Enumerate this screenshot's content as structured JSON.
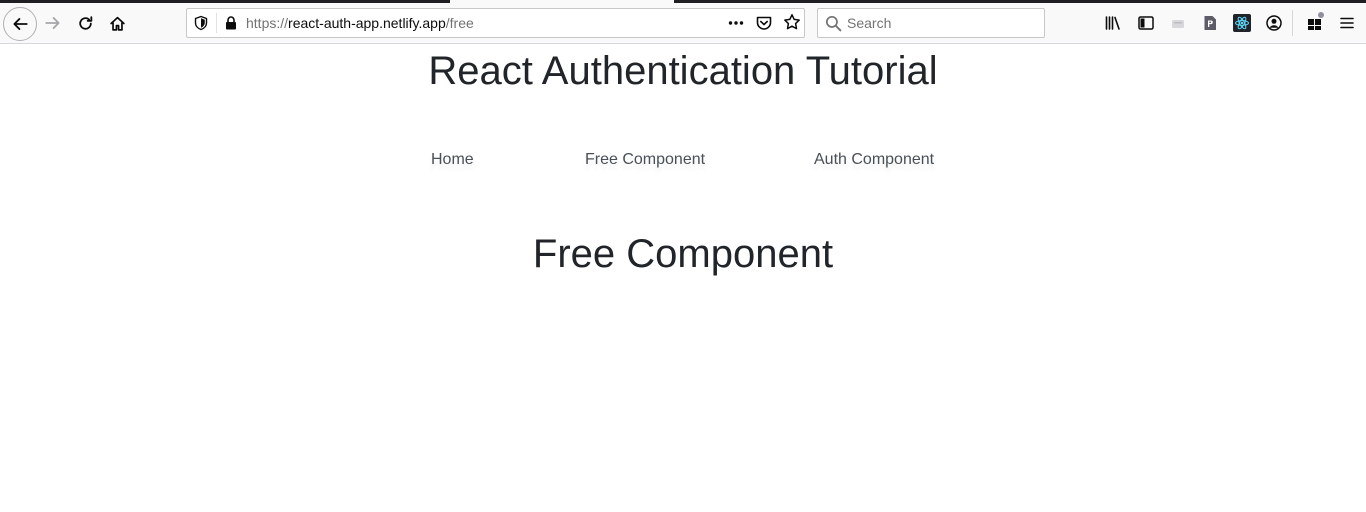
{
  "browser": {
    "url": {
      "scheme": "https://",
      "domain": "react-auth-app.netlify.app",
      "path": "/free"
    },
    "search": {
      "placeholder": "Search",
      "value": ""
    },
    "icons": {
      "back": "back-arrow-icon",
      "forward": "forward-arrow-icon",
      "reload": "reload-icon",
      "home": "home-icon",
      "tracking_protection": "shield-icon",
      "secure": "lock-icon",
      "page_actions": "more-dots-icon",
      "pocket": "pocket-icon",
      "bookmark": "star-icon",
      "search": "search-icon",
      "library": "library-icon",
      "sidebar": "sidebar-icon",
      "account": "account-icon",
      "extensions": "extensions-icon",
      "menu": "hamburger-menu-icon"
    },
    "colors": {
      "toolbar": "#f9f9fa",
      "tab_strip": "#1f1f23"
    }
  },
  "page": {
    "title": "React Authentication Tutorial",
    "nav": [
      {
        "label": "Home"
      },
      {
        "label": "Free Component"
      },
      {
        "label": "Auth Component"
      }
    ],
    "heading": "Free Component"
  }
}
